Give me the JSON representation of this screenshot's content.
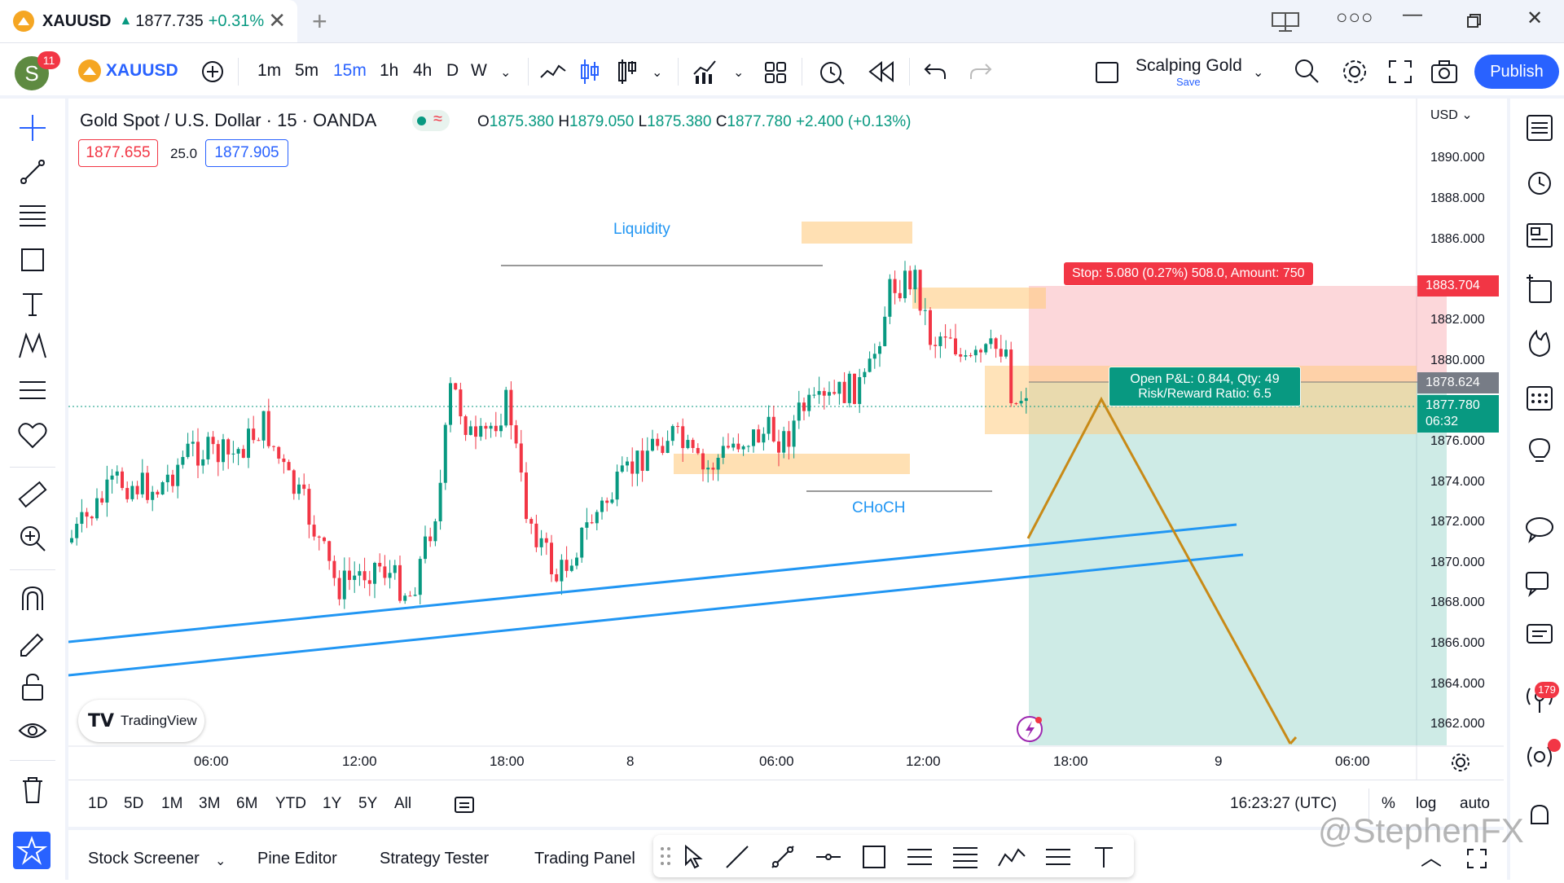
{
  "tab": {
    "symbol": "XAUUSD",
    "arrow": "▲",
    "price": "1877.735",
    "change": "+0.31%"
  },
  "toolbar": {
    "avatar_letter": "S",
    "notif_count": "11",
    "symbol": "XAUUSD",
    "intervals": [
      "1m",
      "5m",
      "15m",
      "1h",
      "4h",
      "D",
      "W"
    ],
    "active_interval": "15m",
    "layout_name": "Scalping Gold",
    "layout_save": "Save",
    "publish": "Publish"
  },
  "legend": {
    "title": "Gold Spot / U.S. Dollar · 15 · OANDA",
    "o_label": "O",
    "o": "1875.380",
    "h_label": "H",
    "h": "1879.050",
    "l_label": "L",
    "l": "1875.380",
    "c_label": "C",
    "c": "1877.780",
    "change": "+2.400 (+0.13%)",
    "bid": "1877.655",
    "spread": "25.0",
    "ask": "1877.905"
  },
  "chart_labels": {
    "liquidity": "Liquidity",
    "choch": "CHoCH",
    "stop_label": "Stop: 5.080 (0.27%) 508.0, Amount: 750",
    "pnl_line1": "Open P&L: 0.844, Qty: 49",
    "pnl_line2": "Risk/Reward Ratio: 6.5",
    "tradingview": "TradingView"
  },
  "price_axis": {
    "currency": "USD",
    "ticks": [
      "1890.000",
      "1888.000",
      "1886.000",
      "1884.000",
      "1882.000",
      "1880.000",
      "1878.000",
      "1876.000",
      "1874.000",
      "1872.000",
      "1870.000",
      "1868.000",
      "1866.000",
      "1864.000",
      "1862.000"
    ],
    "stop_price": "1883.704",
    "entry_price": "1878.624",
    "last_price": "1877.780",
    "countdown": "06:32"
  },
  "time_axis": [
    "06:00",
    "12:00",
    "18:00",
    "8",
    "06:00",
    "12:00",
    "18:00",
    "9",
    "06:00"
  ],
  "range_bar": {
    "ranges": [
      "1D",
      "5D",
      "1M",
      "3M",
      "6M",
      "YTD",
      "1Y",
      "5Y",
      "All"
    ],
    "clock": "16:23:27 (UTC)",
    "pct": "%",
    "log": "log",
    "auto": "auto"
  },
  "bottom_bar": {
    "tabs": [
      "Stock Screener",
      "Pine Editor",
      "Strategy Tester",
      "Trading Panel"
    ]
  },
  "right_badge": "179",
  "watermark": "@StephenFX",
  "colors": {
    "up": "#089981",
    "down": "#f23645",
    "accent": "#2962ff",
    "zone": "#ffcc80",
    "trend": "#2196f3",
    "path": "#c88a17"
  }
}
